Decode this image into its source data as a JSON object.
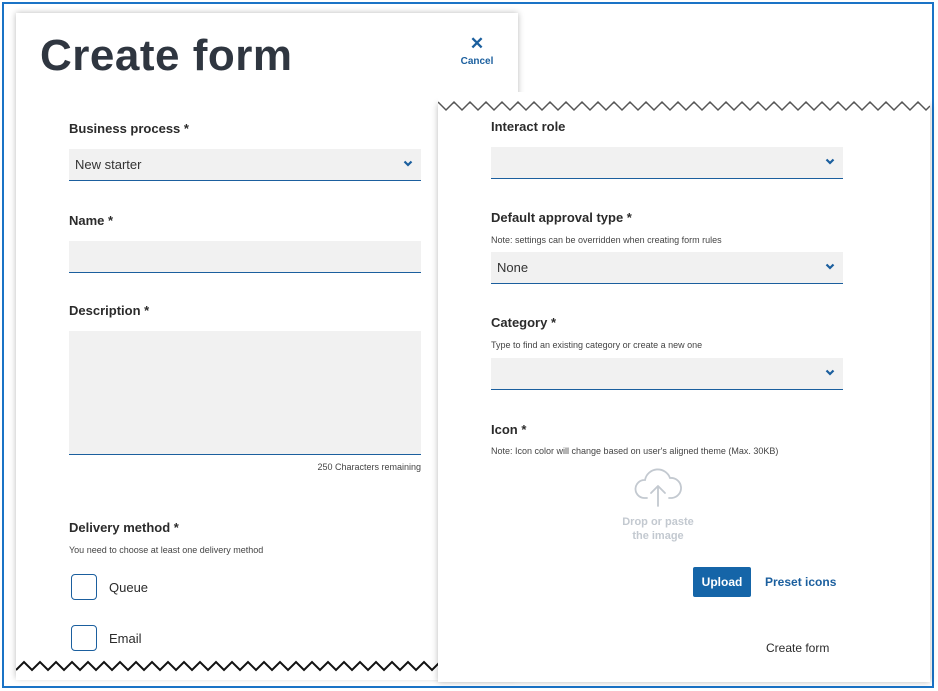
{
  "page_title": "Create form",
  "cancel": {
    "icon": "close-icon",
    "label": "Cancel"
  },
  "business_process": {
    "label": "Business process *",
    "value": "New starter"
  },
  "name": {
    "label": "Name *",
    "value": ""
  },
  "description": {
    "label": "Description *",
    "value": "",
    "counter": "250 Characters remaining"
  },
  "delivery_method": {
    "label": "Delivery method *",
    "note": "You need to choose at least one delivery method",
    "options": [
      {
        "label": "Queue",
        "checked": false
      },
      {
        "label": "Email",
        "checked": false
      }
    ]
  },
  "interact_role": {
    "label": "Interact role",
    "value": ""
  },
  "default_approval_type": {
    "label": "Default approval type *",
    "note": "Note: settings can be overridden when creating form rules",
    "value": "None"
  },
  "category": {
    "label": "Category *",
    "note": "Type to find an existing category or create a new one",
    "value": ""
  },
  "icon_field": {
    "label": "Icon *",
    "note": "Note: Icon color will change based on user's aligned theme (Max. 30KB)",
    "drop_line1": "Drop or paste",
    "drop_line2": "the image",
    "upload_label": "Upload",
    "preset_label": "Preset icons"
  },
  "create_form_label": "Create form",
  "colors": {
    "accent": "#1b5f9e",
    "button": "#1565a8",
    "frame": "#1a73c6",
    "field_bg": "#f1f1f1",
    "title": "#2f3640"
  },
  "icons": [
    "close-icon",
    "chevron-down-icon",
    "cloud-upload-icon"
  ]
}
